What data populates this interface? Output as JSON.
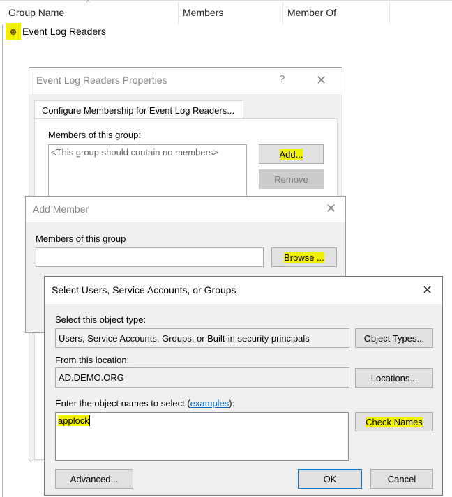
{
  "list": {
    "columns": [
      "Group Name",
      "Members",
      "Member Of"
    ],
    "rows": [
      {
        "name": "Event Log Readers"
      }
    ]
  },
  "properties": {
    "title": "Event Log Readers Properties",
    "help": "?",
    "close": "✕",
    "tab": "Configure Membership for Event Log Readers...",
    "members_label": "Members of this group:",
    "members_placeholder": "<This group should contain no members>",
    "add": "Add...",
    "remove": "Remove"
  },
  "add_member": {
    "title": "Add Member",
    "close": "✕",
    "members_label": "Members of this group",
    "members_value": "",
    "browse": "Browse ..."
  },
  "select": {
    "title": "Select Users, Service Accounts, or Groups",
    "close": "✕",
    "object_type_label": "Select this object type:",
    "object_type_value": "Users, Service Accounts, Groups, or Built-in security principals",
    "object_types_button": "Object Types...",
    "location_label": "From this location:",
    "location_value": "AD.DEMO.ORG",
    "locations_button": "Locations...",
    "names_label_pre": "Enter the object names to select (",
    "names_label_link": "examples",
    "names_label_post": "):",
    "names_value": "applock",
    "check_names": "Check Names",
    "advanced": "Advanced...",
    "ok": "OK",
    "cancel": "Cancel"
  },
  "colors": {
    "highlight": "#f0f000",
    "link": "#0066cc",
    "ok_border": "#0078d7"
  }
}
